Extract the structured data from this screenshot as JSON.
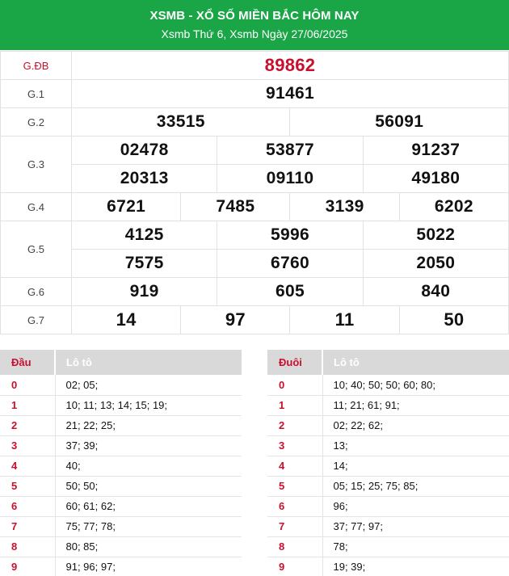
{
  "header": {
    "title": "XSMB - XỔ SỐ MIỀN BẮC HÔM NAY",
    "subtitle": "Xsmb Thứ 6, Xsmb Ngày 27/06/2025"
  },
  "prizes": {
    "db": {
      "label": "G.ĐB",
      "numbers": [
        "89862"
      ]
    },
    "g1": {
      "label": "G.1",
      "numbers": [
        "91461"
      ]
    },
    "g2": {
      "label": "G.2",
      "numbers": [
        "33515",
        "56091"
      ]
    },
    "g3": {
      "label": "G.3",
      "numbers": [
        "02478",
        "53877",
        "91237",
        "20313",
        "09110",
        "49180"
      ]
    },
    "g4": {
      "label": "G.4",
      "numbers": [
        "6721",
        "7485",
        "3139",
        "6202"
      ]
    },
    "g5": {
      "label": "G.5",
      "numbers": [
        "4125",
        "5996",
        "5022",
        "7575",
        "6760",
        "2050"
      ]
    },
    "g6": {
      "label": "G.6",
      "numbers": [
        "919",
        "605",
        "840"
      ]
    },
    "g7": {
      "label": "G.7",
      "numbers": [
        "14",
        "97",
        "11",
        "50"
      ]
    }
  },
  "dau_table": {
    "head_label": "Đầu",
    "loto_label": "Lô tô",
    "rows": [
      {
        "key": "0",
        "value": "02; 05;"
      },
      {
        "key": "1",
        "value": "10; 11; 13; 14; 15; 19;"
      },
      {
        "key": "2",
        "value": "21; 22; 25;"
      },
      {
        "key": "3",
        "value": "37; 39;"
      },
      {
        "key": "4",
        "value": "40;"
      },
      {
        "key": "5",
        "value": "50; 50;"
      },
      {
        "key": "6",
        "value": "60; 61; 62;"
      },
      {
        "key": "7",
        "value": "75; 77; 78;"
      },
      {
        "key": "8",
        "value": "80; 85;"
      },
      {
        "key": "9",
        "value": "91; 96; 97;"
      }
    ]
  },
  "duoi_table": {
    "head_label": "Đuôi",
    "loto_label": "Lô tô",
    "rows": [
      {
        "key": "0",
        "value": "10; 40; 50; 50; 60; 80;"
      },
      {
        "key": "1",
        "value": "11; 21; 61; 91;"
      },
      {
        "key": "2",
        "value": "02; 22; 62;"
      },
      {
        "key": "3",
        "value": "13;"
      },
      {
        "key": "4",
        "value": "14;"
      },
      {
        "key": "5",
        "value": "05; 15; 25; 75; 85;"
      },
      {
        "key": "6",
        "value": "96;"
      },
      {
        "key": "7",
        "value": "37; 77; 97;"
      },
      {
        "key": "8",
        "value": "78;"
      },
      {
        "key": "9",
        "value": "19; 39;"
      }
    ]
  },
  "colors": {
    "header_bg": "#1aa547",
    "special_prize": "#c8102e",
    "loto_key": "#c8102e",
    "loto_header_bg": "#d9d9d9"
  }
}
